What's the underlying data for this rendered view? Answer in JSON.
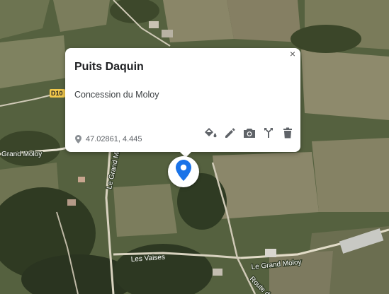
{
  "map": {
    "roads": {
      "grand_moloy_left": "Grand Moloy",
      "le_grand_moloy_vertical": "Le Grand Mo",
      "les_vaises": "Les Vaises",
      "le_grand_moloy_right": "Le Grand Moloy",
      "route_des": "Route des",
      "route_badge": "D10"
    }
  },
  "info_window": {
    "title": "Puits Daquin",
    "description": "Concession du Moloy",
    "coordinates": "47.02861, 4.445",
    "close_symbol": "×",
    "tools": [
      {
        "name": "paint-bucket-icon"
      },
      {
        "name": "pencil-icon"
      },
      {
        "name": "camera-icon"
      },
      {
        "name": "directions-icon"
      },
      {
        "name": "trash-icon"
      }
    ]
  },
  "marker": {
    "icon": "map-pin-icon",
    "color": "#1a73e8"
  }
}
